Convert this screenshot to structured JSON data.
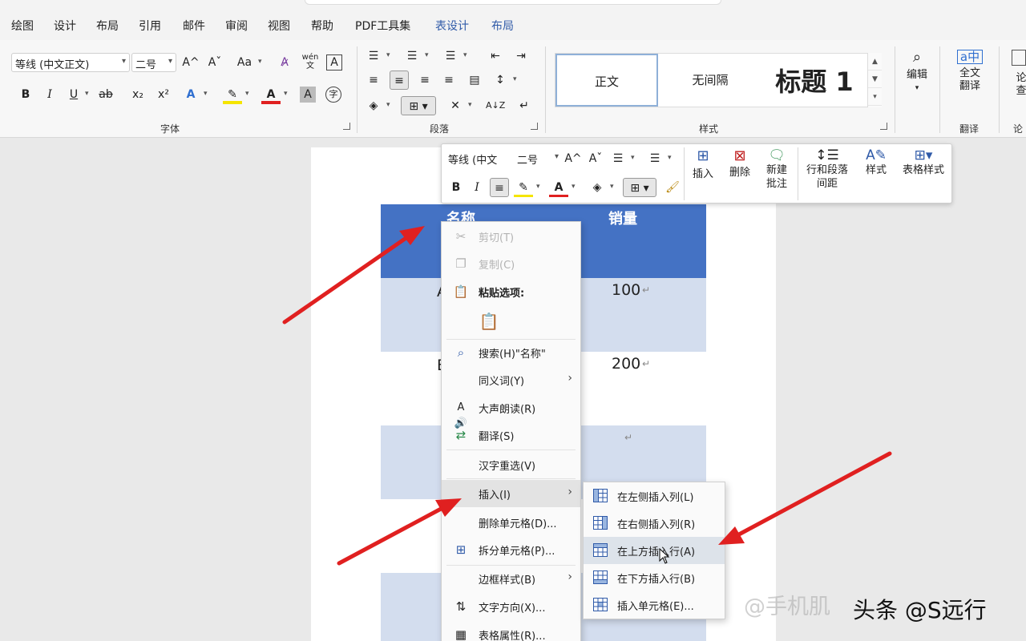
{
  "menubar": {
    "tabs": [
      "绘图",
      "设计",
      "布局",
      "引用",
      "邮件",
      "审阅",
      "视图",
      "帮助",
      "PDF工具集",
      "表设计",
      "布局"
    ]
  },
  "ribbon": {
    "font_name": "等线 (中文正文)",
    "font_size": "二号",
    "group_font": "字体",
    "group_paragraph": "段落",
    "group_styles": "样式",
    "group_translate": "翻译",
    "styles": [
      "正文",
      "无间隔",
      "标题 1"
    ],
    "edit_label": "编辑",
    "translate_label_1": "全文",
    "translate_label_2": "翻译",
    "cut_off_1": "论",
    "cut_off_2": "查",
    "cut_off_3": "论",
    "font_buttons": {
      "bold": "B",
      "italic": "I",
      "underline": "U",
      "strike": "ab",
      "sub": "x₂",
      "sup": "x²",
      "grow": "A^",
      "shrink": "Aˇ",
      "case": "Aa",
      "char_shading": "A",
      "char_border": "A"
    }
  },
  "document": {
    "header_col1": "名称",
    "header_col2": "销量",
    "row1_value": "100",
    "row2_value": "200",
    "row1_left": "A",
    "row2_left": "B",
    "return_mark": "↵"
  },
  "mini_toolbar": {
    "font_name": "等线 (中文",
    "font_size": "二号",
    "insert_label": "插入",
    "delete_label": "删除",
    "new_comment_1": "新建",
    "new_comment_2": "批注",
    "spacing_1": "行和段落",
    "spacing_2": "间距",
    "styles_label": "样式",
    "table_styles_label": "表格样式"
  },
  "context_menu": {
    "items": [
      {
        "label": "剪切(T)",
        "disabled": true
      },
      {
        "label": "复制(C)",
        "disabled": true
      },
      {
        "label": "粘贴选项:",
        "bold": true
      },
      {
        "label": "搜索(H)\"名称\""
      },
      {
        "label": "同义词(Y)",
        "submenu": true
      },
      {
        "label": "大声朗读(R)"
      },
      {
        "label": "翻译(S)"
      },
      {
        "label": "汉字重选(V)"
      },
      {
        "label": "插入(I)",
        "submenu": true,
        "highlighted": true
      },
      {
        "label": "删除单元格(D)..."
      },
      {
        "label": "拆分单元格(P)..."
      },
      {
        "label": "边框样式(B)",
        "submenu": true
      },
      {
        "label": "文字方向(X)..."
      },
      {
        "label": "表格属性(R)..."
      }
    ],
    "submenu_arrow": "›"
  },
  "insert_submenu": {
    "items": [
      {
        "label": "在左侧插入列(L)"
      },
      {
        "label": "在右侧插入列(R)"
      },
      {
        "label": "在上方插入行(A)",
        "highlighted": true
      },
      {
        "label": "在下方插入行(B)"
      },
      {
        "label": "插入单元格(E)..."
      }
    ]
  },
  "watermark": "@手机肌",
  "brand": "头条 @S远行",
  "colors": {
    "table_header": "#4472c4",
    "table_band": "#d3ddee",
    "arrow": "#e02020",
    "context_tab": "#2f5aa8"
  }
}
